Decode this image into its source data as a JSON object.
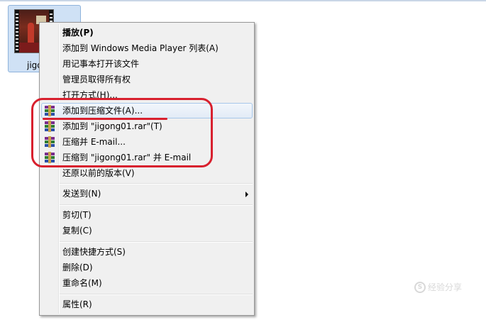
{
  "file": {
    "name": "jigong01"
  },
  "menu": {
    "items": [
      {
        "label": "播放(P)"
      },
      {
        "label": "添加到 Windows Media Player 列表(A)"
      },
      {
        "label": "用记事本打开该文件"
      },
      {
        "label": "管理员取得所有权"
      },
      {
        "label": "打开方式(H)..."
      },
      {
        "label": "添加到压缩文件(A)...",
        "icon": "winrar-icon"
      },
      {
        "label": "添加到 \"jigong01.rar\"(T)",
        "icon": "winrar-icon"
      },
      {
        "label": "压缩并 E-mail...",
        "icon": "winrar-icon"
      },
      {
        "label": "压缩到 \"jigong01.rar\" 并 E-mail",
        "icon": "winrar-icon"
      },
      {
        "label": "还原以前的版本(V)"
      },
      {
        "label": "发送到(N)"
      },
      {
        "label": "剪切(T)"
      },
      {
        "label": "复制(C)"
      },
      {
        "label": "创建快捷方式(S)"
      },
      {
        "label": "删除(D)"
      },
      {
        "label": "重命名(M)"
      },
      {
        "label": "属性(R)"
      }
    ]
  },
  "watermark": {
    "text": "经验分享"
  },
  "colors": {
    "annotation": "#d8202e",
    "hover_border": "#a8c8ea",
    "menu_bg": "#f0f0f0"
  }
}
